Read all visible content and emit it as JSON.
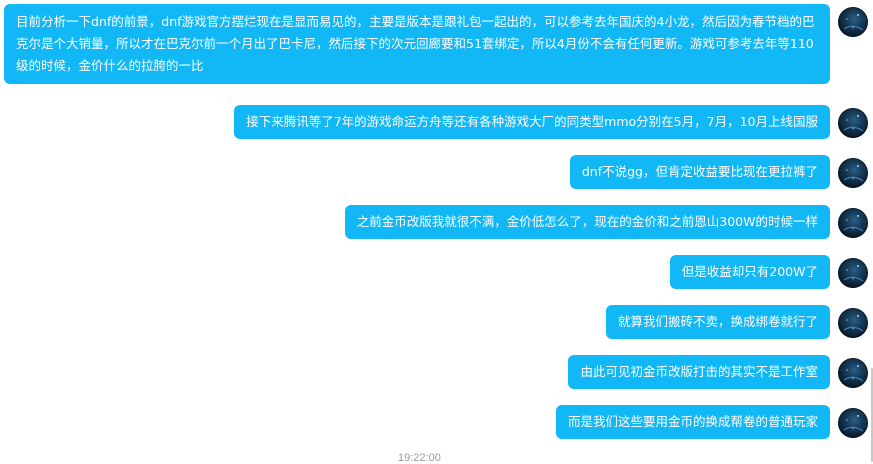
{
  "messages": [
    {
      "text": "目前分析一下dnf的前景，dnf游戏官方摆烂现在是显而易见的，主要是版本是跟礼包一起出的，可以参考去年国庆的4小龙，然后因为春节档的巴克尔是个大销量，所以才在巴克尔前一个月出了巴卡尼，然后接下的次元回廊要和51套绑定，所以4月份不会有任何更新。游戏可参考去年等110级的时候，金价什么的拉胯的一比"
    },
    {
      "text": "接下来腾讯等了7年的游戏命运方舟等还有各种游戏大厂的同类型mmo分别在5月，7月，10月上线国服"
    },
    {
      "text": "dnf不说gg，但肯定收益要比现在更拉裤了"
    },
    {
      "text": "之前金币改版我就很不满，金价低怎么了，现在的金价和之前恩山300W的时候一样"
    },
    {
      "text": "但是收益却只有200W了"
    },
    {
      "text": "就算我们搬砖不卖，换成绑卷就行了"
    },
    {
      "text": "由此可见初金币改版打击的其实不是工作室"
    },
    {
      "text": "而是我们这些要用金币的换成帮卷的普通玩家"
    }
  ],
  "timestamp": "19:22:00",
  "colors": {
    "bubble": "#12b7f5",
    "bubble_text": "#ffffff",
    "timestamp": "#9a9a9a"
  },
  "avatar_icon": "user-avatar-icon"
}
